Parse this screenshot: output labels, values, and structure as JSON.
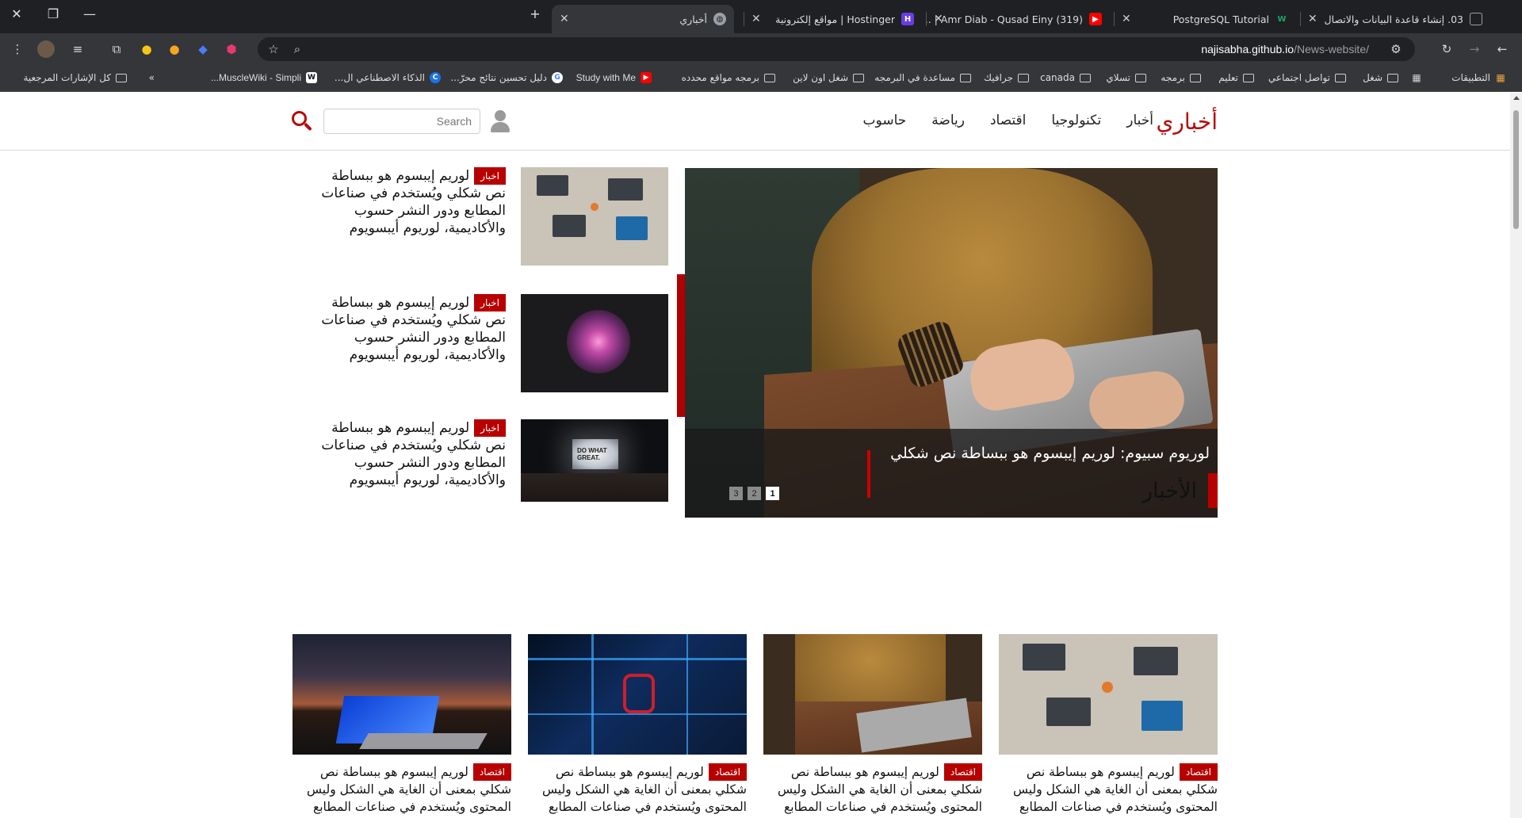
{
  "browser": {
    "tabs": [
      {
        "title": "03. إنشاء قاعدة البيانات والاتصال",
        "icon": "page-icon",
        "color": "#5f6368"
      },
      {
        "title": "PostgreSQL Tutorial",
        "icon": "w-icon",
        "color": "#1fa463"
      },
      {
        "title": "(319) Amr Diab - Qusad Einy | ...",
        "icon": "youtube-icon",
        "color": "#ff0000"
      },
      {
        "title": "Hostinger | مواقع إلكترونية",
        "icon": "hostinger-icon",
        "color": "#673de6"
      },
      {
        "title": "أخباري",
        "icon": "globe-icon",
        "color": "#9aa0a6"
      }
    ],
    "url_host": "najisabha.github.io",
    "url_path": "/News-website/",
    "bookmarks": [
      {
        "label": "التطبيقات",
        "icon": "apps-grid-icon"
      },
      {
        "label": "شغل",
        "icon": "folder-icon"
      },
      {
        "label": "تواصل اجتماعي",
        "icon": "folder-icon"
      },
      {
        "label": "تعليم",
        "icon": "folder-icon"
      },
      {
        "label": "برمجه",
        "icon": "folder-icon"
      },
      {
        "label": "تسلاي",
        "icon": "folder-icon"
      },
      {
        "label": "canada",
        "icon": "folder-icon"
      },
      {
        "label": "جرافيك",
        "icon": "folder-icon"
      },
      {
        "label": "مساعدة في البرمجه",
        "icon": "folder-icon"
      },
      {
        "label": "شغل اون لاين",
        "icon": "folder-icon"
      },
      {
        "label": "برمجه مواقع محدده",
        "icon": "folder-icon"
      },
      {
        "label": "Study with Me",
        "icon": "youtube-icon"
      },
      {
        "label": "دليل تحسين نتائج محرّ...",
        "icon": "google-icon"
      },
      {
        "label": "الذكاء الاصطناعي ال...",
        "icon": "c-icon"
      },
      {
        "label": "MuscleWiki - Simpli...",
        "icon": "musclewiki-icon"
      }
    ],
    "all_bookmarks_label": "كل الإشارات المرجعية"
  },
  "site": {
    "logo": "أخباري",
    "nav": [
      "أخبار",
      "تكنولوجيا",
      "اقتصاد",
      "رياضة",
      "حاسوب"
    ],
    "search_placeholder": "Search",
    "accent_color": "#b70a0a"
  },
  "hero": {
    "caption": "لوريوم سبيوم: لوريم إيبسوم هو ببساطة نص شكلي",
    "pages": [
      "1",
      "2",
      "3"
    ],
    "active_page": "1"
  },
  "side_articles": [
    {
      "tag": "اخبار",
      "text": "لوريم إيبسوم هو ببساطة نص شكلي ويُستخدم في صناعات المطابع ودور النشر حسوب والأكاديمية، لوريوم أيبسويوم"
    },
    {
      "tag": "اخبار",
      "text": "لوريم إيبسوم هو ببساطة نص شكلي ويُستخدم في صناعات المطابع ودور النشر حسوب والأكاديمية، لوريوم أيبسويوم"
    },
    {
      "tag": "اخبار",
      "text": "لوريم إيبسوم هو ببساطة نص شكلي ويُستخدم في صناعات المطابع ودور النشر حسوب والأكاديمية، لوريوم أيبسويوم"
    }
  ],
  "section": {
    "title": "الأخبار"
  },
  "cards": [
    {
      "tag": "اقتصاد",
      "text": "لوريم إيبسوم هو ببساطة نص شكلي بمعنى أن الغاية هي الشكل وليس المحتوى ويُستخدم في صناعات المطابع"
    },
    {
      "tag": "اقتصاد",
      "text": "لوريم إيبسوم هو ببساطة نص شكلي بمعنى أن الغاية هي الشكل وليس المحتوى ويُستخدم في صناعات المطابع"
    },
    {
      "tag": "اقتصاد",
      "text": "لوريم إيبسوم هو ببساطة نص شكلي بمعنى أن الغاية هي الشكل وليس المحتوى ويُستخدم في صناعات المطابع"
    },
    {
      "tag": "اقتصاد",
      "text": "لوريم إيبسوم هو ببساطة نص شكلي بمعنى أن الغاية هي الشكل وليس المحتوى ويُستخدم في صناعات المطابع"
    }
  ]
}
